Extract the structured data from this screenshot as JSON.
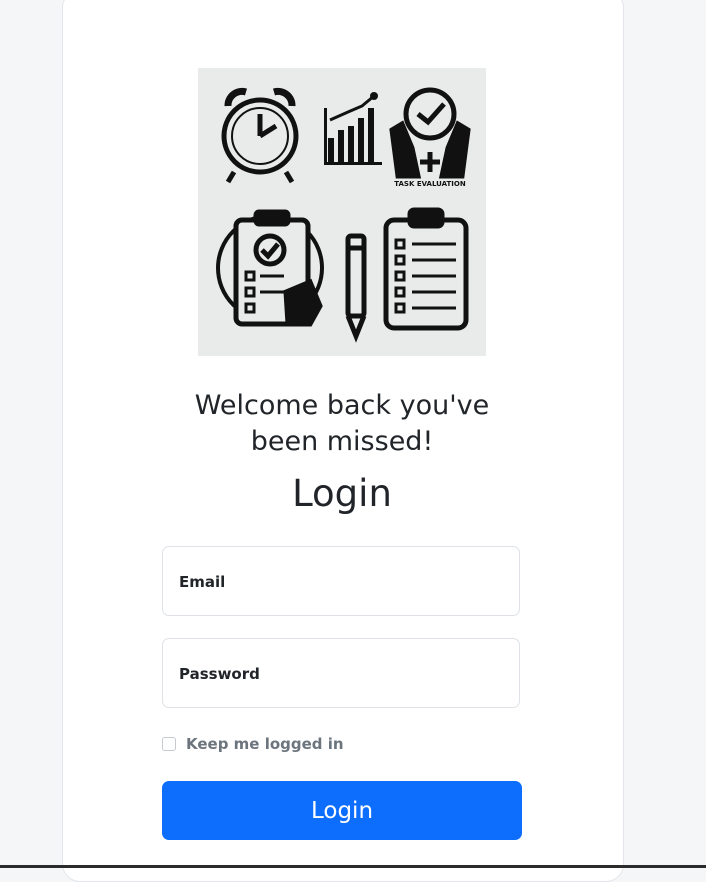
{
  "illustration": {
    "caption": "TASK EVALUATION"
  },
  "welcome": {
    "line1": "Welcome back you've",
    "line2": "been missed!"
  },
  "form": {
    "title": "Login",
    "email_label": "Email",
    "password_label": "Password",
    "remember_label": "Keep me logged in",
    "remember_checked": false,
    "submit_label": "Login"
  },
  "colors": {
    "primary": "#0d6efd",
    "background": "#f5f6f8",
    "card": "#ffffff"
  }
}
